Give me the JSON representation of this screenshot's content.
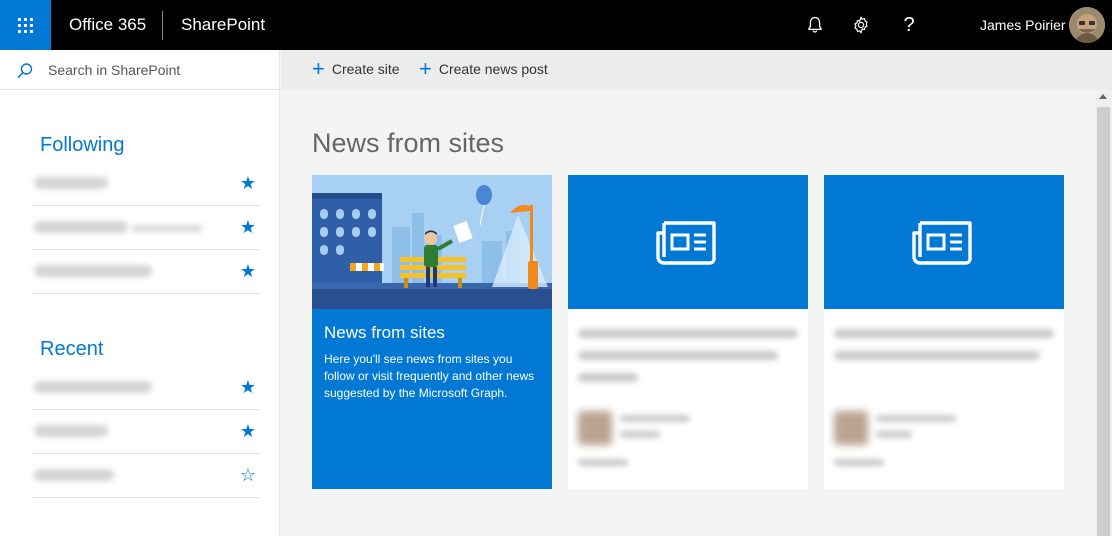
{
  "suitebar": {
    "brand": "Office 365",
    "app_name": "SharePoint",
    "user_name": "James Poirier",
    "icons": [
      "waffle-icon",
      "bell-icon",
      "gear-icon",
      "help-icon"
    ],
    "help_glyph": "?",
    "accent": "#0078d4"
  },
  "search": {
    "placeholder": "Search in SharePoint"
  },
  "commands": {
    "create_site": "Create site",
    "create_news_post": "Create news post"
  },
  "following": {
    "title": "Following",
    "items": [
      {
        "starred": true
      },
      {
        "starred": true
      },
      {
        "starred": true
      }
    ]
  },
  "recent": {
    "title": "Recent",
    "items": [
      {
        "starred": true
      },
      {
        "starred": true
      },
      {
        "starred": false
      }
    ]
  },
  "main": {
    "title": "News from sites",
    "cards": [
      {
        "title": "News from sites",
        "description": "Here you'll see news from sites you follow or visit frequently and other news suggested by the Microsoft Graph."
      },
      {
        "icon": "newspaper-icon"
      },
      {
        "icon": "newspaper-icon"
      }
    ]
  }
}
